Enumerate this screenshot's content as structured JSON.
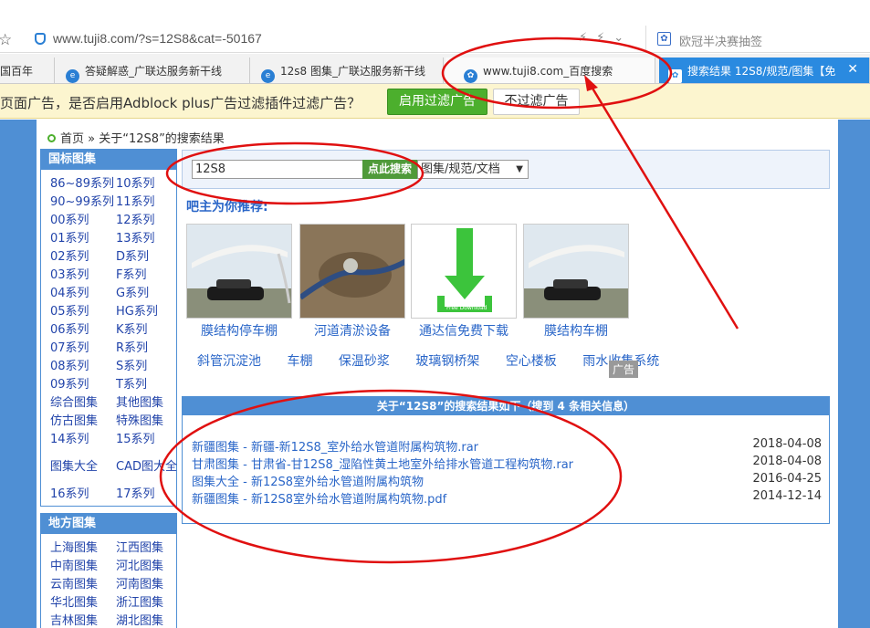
{
  "browser": {
    "url": "www.tuji8.com/?s=12S8&cat=-50167",
    "search_box_text": "欧冠半决赛抽签"
  },
  "tabs": [
    {
      "label": "国百年"
    },
    {
      "label": "答疑解惑_广联达服务新干线"
    },
    {
      "label": "12s8 图集_广联达服务新干线"
    },
    {
      "label": "www.tuji8.com_百度搜索"
    },
    {
      "label": "搜索结果 12S8/规范/图集【免"
    }
  ],
  "adbar": {
    "message": "页面广告，是否启用Adblock plus广告过滤插件过滤广告？",
    "enable_label": "启用过滤广告",
    "disable_label": "不过滤广告"
  },
  "breadcrumb": {
    "home": "首页",
    "sep": "»",
    "current": "关于“12S8”的搜索结果"
  },
  "sidebar": {
    "guobiao_title": "国标图集",
    "guobiao_items": [
      "86~89系列",
      "10系列",
      "90~99系列",
      "11系列",
      "00系列",
      "12系列",
      "01系列",
      "13系列",
      "02系列",
      "D系列",
      "03系列",
      "F系列",
      "04系列",
      "G系列",
      "05系列",
      "HG系列",
      "06系列",
      "K系列",
      "07系列",
      "R系列",
      "08系列",
      "S系列",
      "09系列",
      "T系列",
      "综合图集",
      "其他图集",
      "仿古图集",
      "特殊图集",
      "14系列",
      "15系列",
      "图集大全",
      "CAD图大全",
      "16系列",
      "17系列"
    ],
    "difang_title": "地方图集",
    "difang_items": [
      "上海图集",
      "江西图集",
      "中南图集",
      "河北图集",
      "云南图集",
      "河南图集",
      "华北图集",
      "浙江图集",
      "吉林图集",
      "湖北图集"
    ]
  },
  "search": {
    "value": "12S8",
    "button": "点此搜索",
    "select": "图集/规范/文档"
  },
  "recommend": {
    "title": "吧主为你推荐:",
    "items": [
      "膜结构停车棚",
      "河道清淤设备",
      "通达信免费下载",
      "膜结构车棚"
    ],
    "download_text": "Free Download",
    "keywords": [
      "斜管沉淀池",
      "车棚",
      "保温砂浆",
      "玻璃钢桥架",
      "空心楼板",
      "雨水收集系统"
    ],
    "ad_label": "广告"
  },
  "results": {
    "header": "关于“12S8”的搜索结果如下（搜到 4 条相关信息）",
    "rows": [
      {
        "title": "新疆图集 - 新疆-新12S8_室外给水管道附属构筑物.rar",
        "date": "2018-04-08"
      },
      {
        "title": "甘肃图集 - 甘肃省-甘12S8_湿陷性黄土地室外给排水管道工程构筑物.rar",
        "date": "2018-04-08"
      },
      {
        "title": "图集大全 - 新12S8室外给水管道附属构筑物",
        "date": "2016-04-25"
      },
      {
        "title": "新疆图集 - 新12S8室外给水管道附属构筑物.pdf",
        "date": "2014-12-14"
      }
    ]
  },
  "colors": {
    "accent": "#4f8fd4",
    "annotation": "#e01010",
    "green_button": "#4caf2d"
  }
}
